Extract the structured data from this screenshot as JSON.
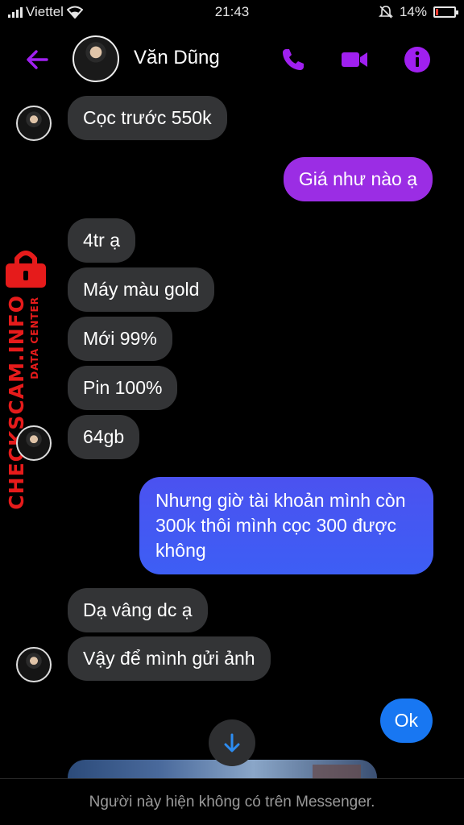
{
  "status_bar": {
    "carrier": "Viettel",
    "time": "21:43",
    "battery": "14%",
    "battery_level": 0.14
  },
  "header": {
    "contact_name": "Văn Dũng",
    "accent_color": "#a020f0"
  },
  "messages": [
    {
      "id": "m1",
      "direction": "in",
      "text": "Cọc trước 550k"
    },
    {
      "id": "m2",
      "direction": "out",
      "text": "Giá như nào ạ"
    },
    {
      "id": "m3",
      "direction": "in",
      "text": "4tr ạ"
    },
    {
      "id": "m4",
      "direction": "in",
      "text": "Máy màu gold"
    },
    {
      "id": "m5",
      "direction": "in",
      "text": "Mới 99%"
    },
    {
      "id": "m6",
      "direction": "in",
      "text": "Pin 100%"
    },
    {
      "id": "m7",
      "direction": "in",
      "text": "64gb"
    },
    {
      "id": "m8",
      "direction": "out",
      "text": "Nhưng giờ tài khoản mình còn 300k thôi mình cọc 300 được không"
    },
    {
      "id": "m9",
      "direction": "in",
      "text": "Dạ vâng dc ạ"
    },
    {
      "id": "m10",
      "direction": "in",
      "text": "Vậy để mình gửi ảnh"
    },
    {
      "id": "m11",
      "direction": "out",
      "text": "Ok"
    }
  ],
  "watermark": {
    "main": "CHECKSCAM.INFO",
    "sub": "DATA CENTER",
    "color": "#e61b1b"
  },
  "footer": {
    "notice": "Người này hiện không có trên Messenger."
  }
}
